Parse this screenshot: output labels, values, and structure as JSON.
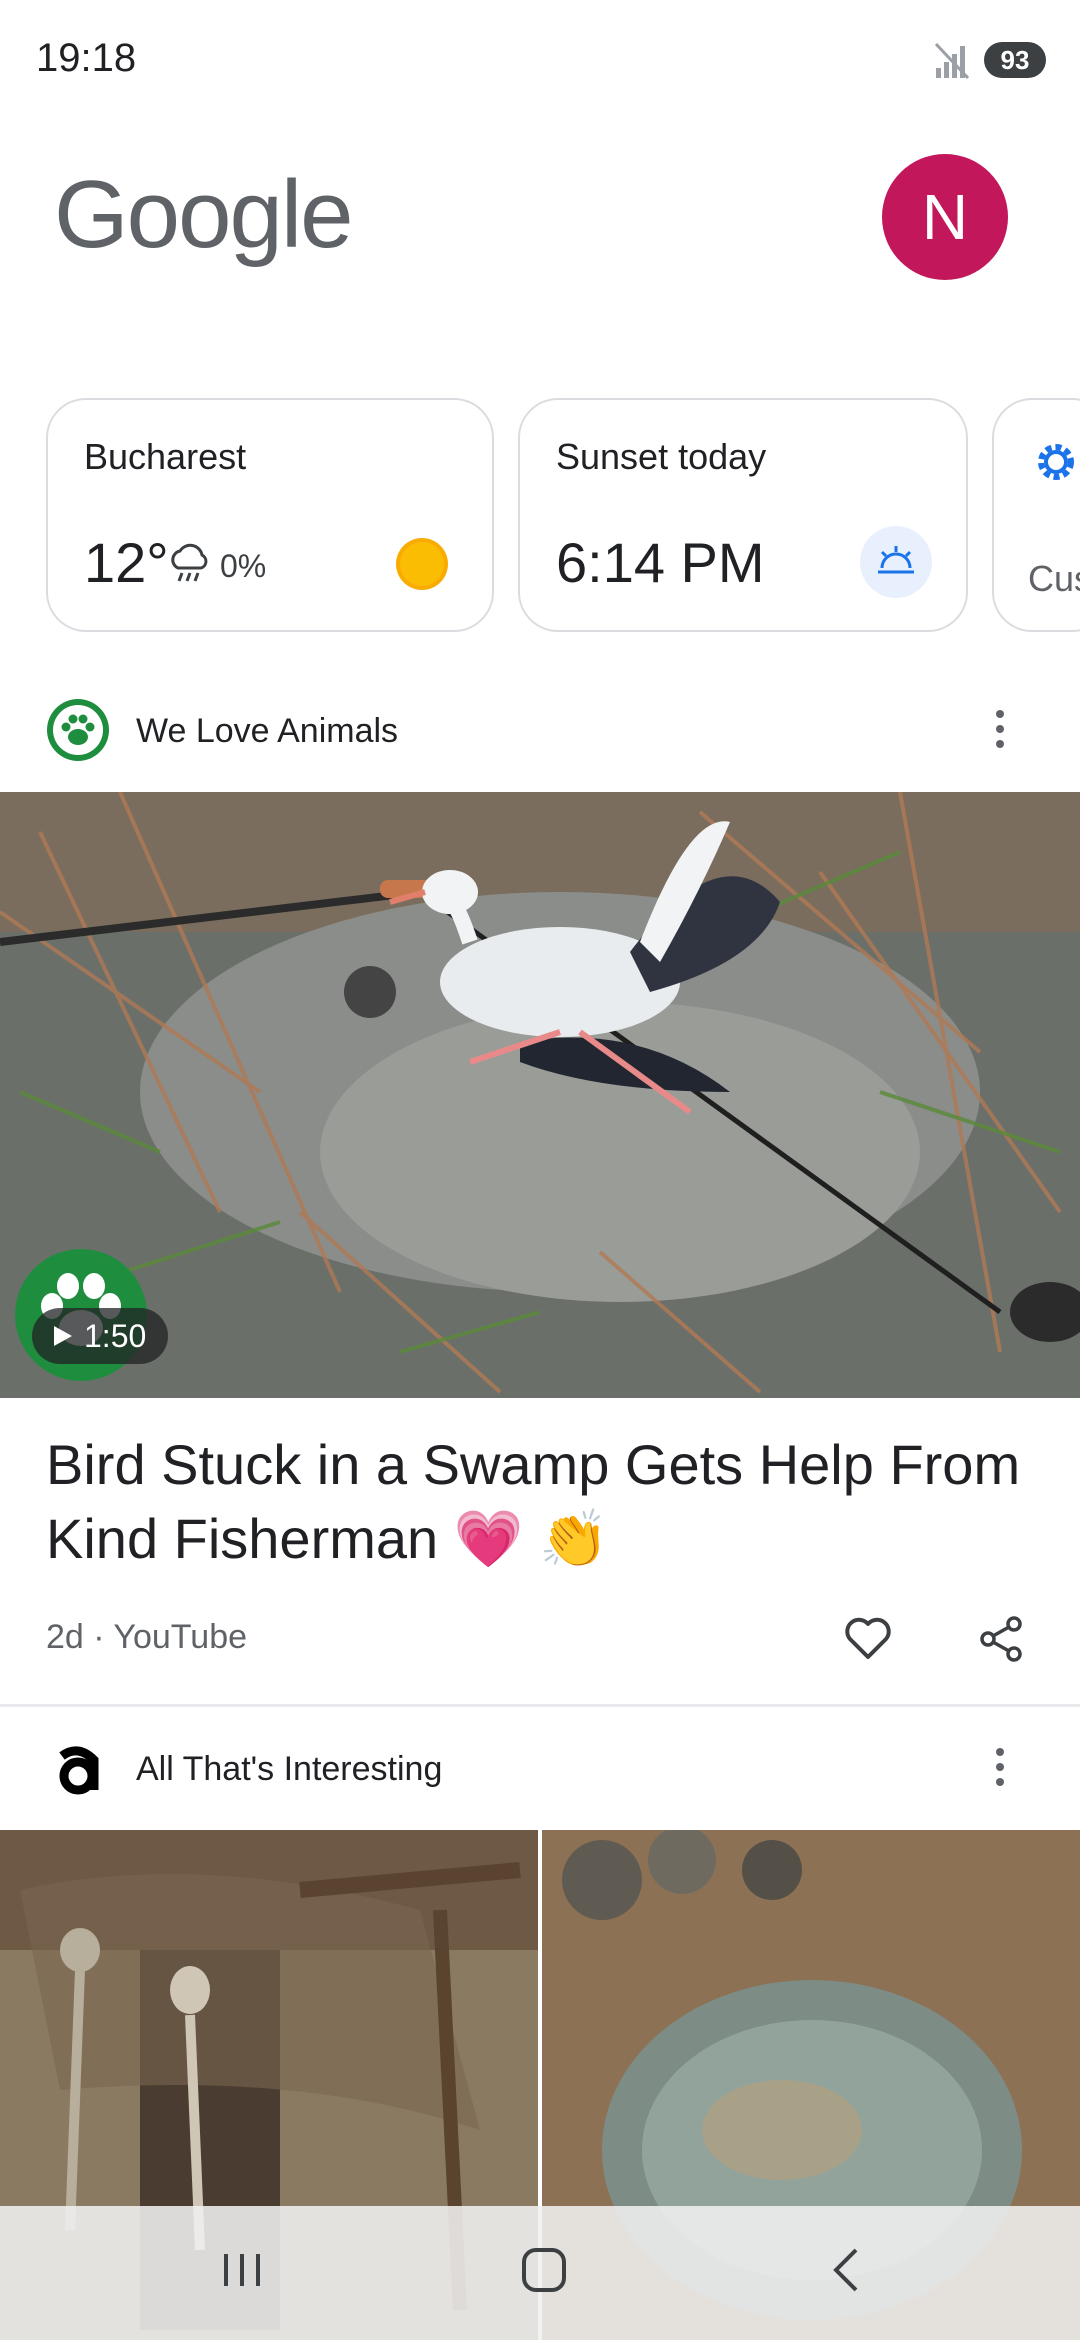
{
  "status_bar": {
    "time": "19:18",
    "battery": "93"
  },
  "header": {
    "logo": "Google",
    "avatar_initial": "N"
  },
  "cards": {
    "weather": {
      "city": "Bucharest",
      "temp": "12°",
      "precip": "0%"
    },
    "sunset": {
      "title": "Sunset today",
      "time": "6:14 PM"
    },
    "customize": {
      "label": "Cus"
    }
  },
  "feed": [
    {
      "source": "We Love Animals",
      "duration": "1:50",
      "headline": "Bird Stuck in a Swamp Gets Help From Kind Fisherman 💗 👏",
      "meta": "2d · YouTube"
    },
    {
      "source": "All That's Interesting"
    }
  ],
  "colors": {
    "avatar": "#c2185b",
    "accent": "#1a73e8",
    "sun": "#f9ab00"
  }
}
